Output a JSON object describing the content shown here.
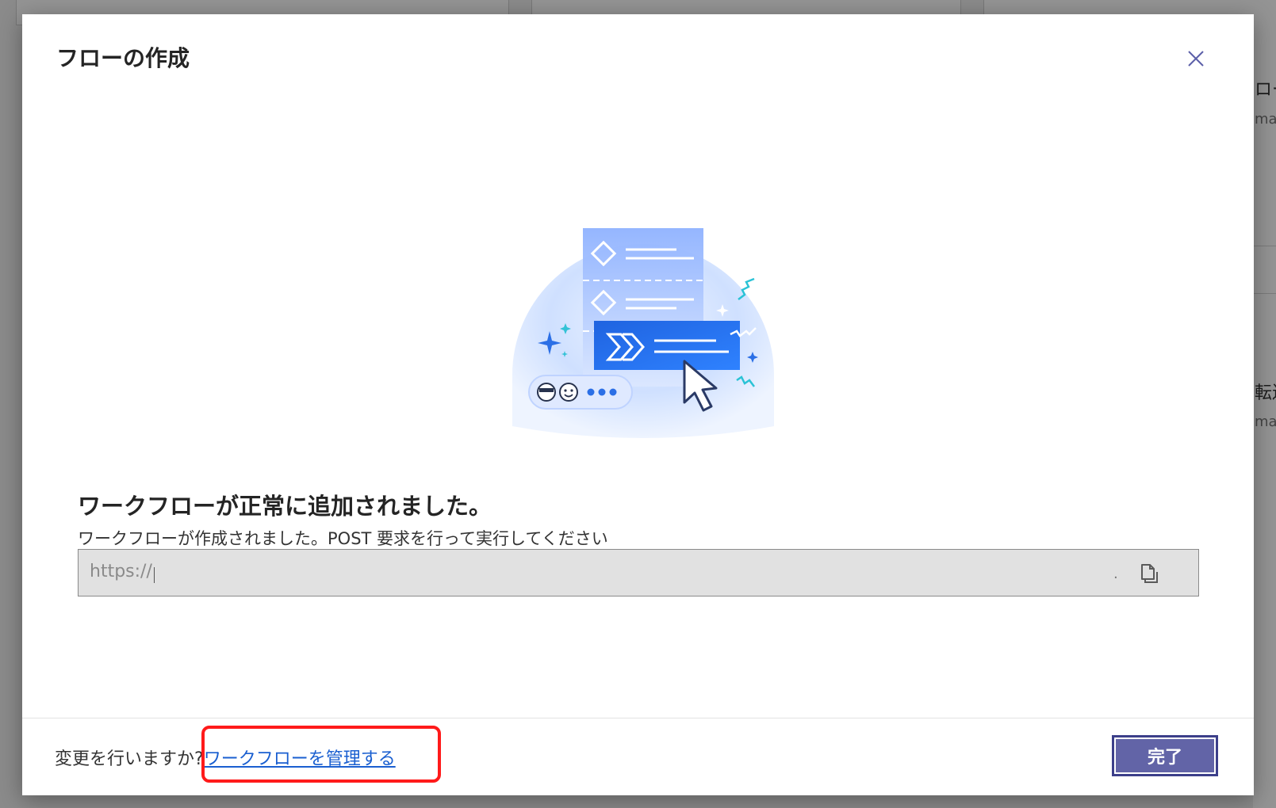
{
  "background": {
    "side_fragments": [
      "ロー",
      "mat",
      "転送",
      "mat"
    ]
  },
  "dialog": {
    "title": "フローの作成",
    "success_title": "ワークフローが正常に追加されました。",
    "success_subtitle": "ワークフローが作成されました。POST 要求を行って実行してください",
    "url": {
      "value": "https://",
      "trailing_char": "."
    },
    "footer": {
      "prompt": "変更を行いますか?",
      "manage_link": "ワークフローを管理する"
    },
    "done_button": "完了"
  },
  "icons": {
    "close": "close-icon",
    "copy": "copy-icon"
  },
  "colors": {
    "accent": "#6264a7",
    "link": "#1a5fd0",
    "highlight": "#ff1a1a",
    "illustration_blue": "#2b6fe6"
  }
}
